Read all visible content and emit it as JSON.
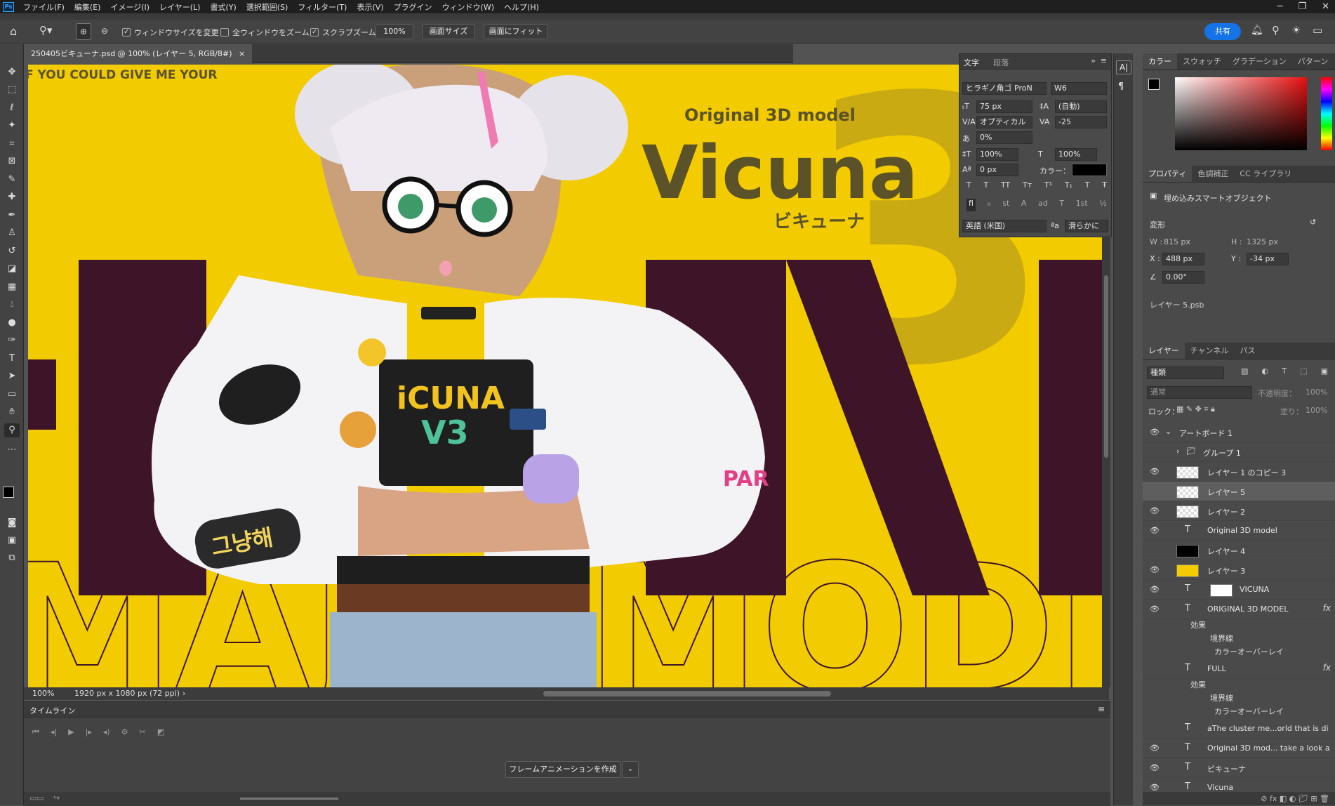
{
  "app": {
    "logo": "Ps"
  },
  "menu": [
    "ファイル(F)",
    "編集(E)",
    "イメージ(I)",
    "レイヤー(L)",
    "書式(Y)",
    "選択範囲(S)",
    "フィルター(T)",
    "表示(V)",
    "プラグイン",
    "ウィンドウ(W)",
    "ヘルプ(H)"
  ],
  "options": {
    "resize_windows": "ウィンドウサイズを変更",
    "zoom_all": "全ウィンドウをズーム",
    "scrubby_zoom": "スクラブズーム",
    "zoom_value": "100%",
    "screen_size": "画面サイズ",
    "fit_screen": "画面にフィット",
    "share": "共有"
  },
  "document": {
    "tab_title": "250405ビキューナ.psd @ 100% (レイヤー 5, RGB/8#)"
  },
  "artwork": {
    "top_text": "F YOU COULD GIVE ME YOUR",
    "subtitle": "Original 3D model",
    "title": "Vicuna",
    "kana": "ビキューナ",
    "big_digit": "3",
    "big_outline": "MAJO MODEL",
    "colors": {
      "yellow": "#f2cc00",
      "maroon": "#3e1528",
      "olive": "#5b5229",
      "light_olive": "#c9aa12"
    }
  },
  "status": {
    "zoom": "100%",
    "size": "1920 px x 1080 px (72 ppi)"
  },
  "timeline": {
    "tab": "タイムライン",
    "create_button": "フレームアニメーションを作成"
  },
  "character_panel": {
    "tabs": [
      "文字",
      "段落"
    ],
    "font": "ヒラギノ角ゴ ProN",
    "weight": "W6",
    "size": "75 px",
    "leading": "(自動)",
    "kerning": "オプティカル",
    "tracking": "-25",
    "tsume": "0%",
    "vscale": "100%",
    "hscale": "100%",
    "baseline": "0 px",
    "color_label": "カラー：",
    "language": "英語 (米国)",
    "aa_label": "ªa",
    "antialias": "滑らかに",
    "style_buttons": [
      "T",
      "T",
      "TT",
      "Tт",
      "T¹",
      "T₁",
      "T",
      "Ŧ"
    ],
    "opentype": [
      "fi",
      "ℴ",
      "st",
      "A",
      "ad",
      "T",
      "1st",
      "½"
    ]
  },
  "color_panel": {
    "tabs": [
      "カラー",
      "スウォッチ",
      "グラデーション",
      "パターン"
    ]
  },
  "properties": {
    "tabs": [
      "プロパティ",
      "色調補正",
      "CC ライブラリ"
    ],
    "type": "埋め込みスマートオブジェクト",
    "transform_label": "変形",
    "w_label": "W :",
    "w": "815 px",
    "h_label": "H :",
    "h": "1325 px",
    "x_label": "X :",
    "x": "488 px",
    "y_label": "Y :",
    "y": "-34 px",
    "angle": "0.00°",
    "linked_file": "レイヤー 5.psb"
  },
  "layers_panel": {
    "tabs": [
      "レイヤー",
      "チャンネル",
      "パス"
    ],
    "filter": "種類",
    "blend": "通常",
    "opacity_label": "不透明度：",
    "opacity": "100%",
    "lock_label": "ロック：",
    "fill_label": "塗り：",
    "fill": "100%",
    "artboard": "アートボード 1",
    "items": [
      {
        "name": "グループ 1",
        "kind": "group",
        "visible": false
      },
      {
        "name": "レイヤー 1 のコピー 3",
        "kind": "thumb",
        "visible": true
      },
      {
        "name": "レイヤー 5",
        "kind": "thumb",
        "visible": false
      },
      {
        "name": "レイヤー 2",
        "kind": "thumb",
        "visible": true
      },
      {
        "name": "Original 3D model",
        "kind": "text",
        "visible": true
      },
      {
        "name": "レイヤー 4",
        "kind": "black",
        "visible": false
      },
      {
        "name": "レイヤー 3",
        "kind": "yellow",
        "visible": true
      },
      {
        "name": "VICUNA",
        "kind": "text",
        "visible": true
      },
      {
        "name": "ORIGINAL 3D MODEL",
        "kind": "text",
        "visible": true
      },
      {
        "name": "FULL",
        "kind": "text",
        "visible": false
      },
      {
        "name": "aThe cluster me...orld that is di",
        "kind": "text",
        "visible": false
      },
      {
        "name": "Original 3D mod... take a look a",
        "kind": "text",
        "visible": true
      },
      {
        "name": "ビキューナ",
        "kind": "text",
        "visible": true
      },
      {
        "name": "Vicuna",
        "kind": "text",
        "visible": true
      }
    ],
    "effects_label": "効果",
    "stroke_label": "境界線",
    "overlay_label": "カラーオーバーレイ",
    "fx_label": "fx"
  }
}
